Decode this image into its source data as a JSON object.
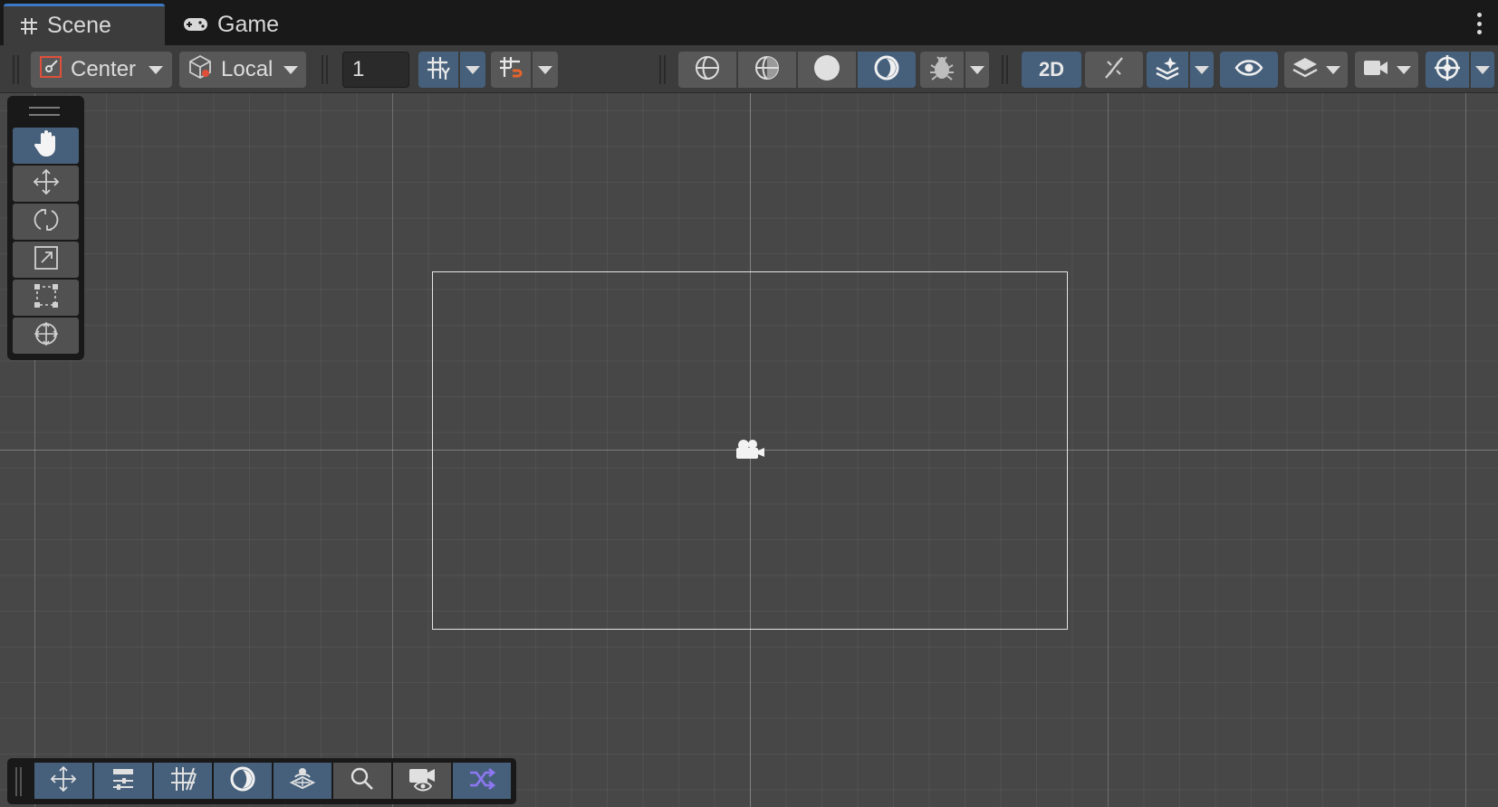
{
  "tabs": [
    {
      "label": "Scene",
      "icon": "scene-grid-icon",
      "active": true
    },
    {
      "label": "Game",
      "icon": "gamepad-icon",
      "active": false
    }
  ],
  "toolbar": {
    "pivot_mode": "Center",
    "pivot_rotation": "Local",
    "grid_snap_value": "1",
    "mode_2d_label": "2D"
  },
  "tools": [
    {
      "name": "hand-tool",
      "icon": "hand-icon",
      "active": true
    },
    {
      "name": "move-tool",
      "icon": "move-arrows-icon",
      "active": false
    },
    {
      "name": "rotate-tool",
      "icon": "rotate-icon",
      "active": false
    },
    {
      "name": "scale-tool",
      "icon": "scale-icon",
      "active": false
    },
    {
      "name": "rect-tool",
      "icon": "rect-transform-icon",
      "active": false
    },
    {
      "name": "transform-tool",
      "icon": "transform-icon",
      "active": false
    }
  ],
  "overlays": [
    "tools-overlay-icon",
    "tool-settings-icon",
    "grid-snapping-icon",
    "draw-modes-icon",
    "view-options-icon",
    "search-icon",
    "cameras-icon",
    "ui-toolkit-overlay-icon"
  ],
  "colors": {
    "tab_accent": "#3c79c4",
    "active_button": "#46607c",
    "scene_background": "#474747",
    "snap_magnet": "#e8642c",
    "overlay_purple": "#8d77f2"
  }
}
